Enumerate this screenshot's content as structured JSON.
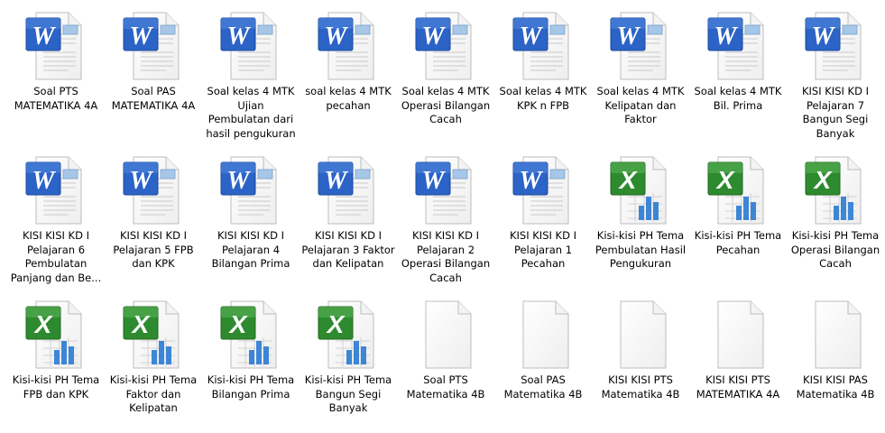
{
  "colors": {
    "word": "#2b63c6",
    "excel": "#2e8a2e",
    "page": "#ffffff",
    "page_edge": "#b9b9b9"
  },
  "files": [
    {
      "name": "Soal PTS\nMATEMATIKA 4A",
      "icon": "word-document-icon"
    },
    {
      "name": "Soal PAS\nMATEMATIKA 4A",
      "icon": "word-document-icon"
    },
    {
      "name": "Soal kelas 4 MTK\nUjian\nPembulatan dari\nhasil pengukuran",
      "icon": "word-document-icon"
    },
    {
      "name": "soal kelas 4 MTK\npecahan",
      "icon": "word-document-icon"
    },
    {
      "name": "Soal kelas 4 MTK\nOperasi Bilangan\nCacah",
      "icon": "word-document-icon"
    },
    {
      "name": "Soal kelas 4 MTK\nKPK n FPB",
      "icon": "word-document-icon"
    },
    {
      "name": "Soal kelas 4 MTK\nKelipatan dan\nFaktor",
      "icon": "word-document-icon"
    },
    {
      "name": "Soal kelas 4 MTK\nBil. Prima",
      "icon": "word-document-icon"
    },
    {
      "name": "KISI KISI KD I\nPelajaran 7\nBangun Segi\nBanyak",
      "icon": "word-document-icon"
    },
    {
      "name": "KISI KISI KD I\nPelajaran 6\nPembulatan\nPanjang dan Be...",
      "icon": "word-document-icon"
    },
    {
      "name": "KISI KISI KD I\nPelajaran 5 FPB\ndan KPK",
      "icon": "word-document-icon"
    },
    {
      "name": "KISI KISI KD I\nPelajaran 4\nBilangan Prima",
      "icon": "word-document-icon"
    },
    {
      "name": "KISI KISI KD I\nPelajaran 3 Faktor\ndan Kelipatan",
      "icon": "word-document-icon"
    },
    {
      "name": "KISI KISI KD I\nPelajaran 2\nOperasi Bilangan\nCacah",
      "icon": "word-document-icon"
    },
    {
      "name": "KISI KISI KD I\nPelajaran 1\nPecahan",
      "icon": "word-document-icon"
    },
    {
      "name": "Kisi-kisi PH Tema\nPembulatan Hasil\nPengukuran",
      "icon": "excel-spreadsheet-icon"
    },
    {
      "name": "Kisi-kisi PH Tema\nPecahan",
      "icon": "excel-spreadsheet-icon"
    },
    {
      "name": "Kisi-kisi PH Tema\nOperasi Bilangan\nCacah",
      "icon": "excel-spreadsheet-icon"
    },
    {
      "name": "Kisi-kisi PH Tema\nFPB dan KPK",
      "icon": "excel-spreadsheet-icon"
    },
    {
      "name": "Kisi-kisi PH Tema\nFaktor dan\nKelipatan",
      "icon": "excel-spreadsheet-icon"
    },
    {
      "name": "Kisi-kisi PH Tema\nBilangan Prima",
      "icon": "excel-spreadsheet-icon"
    },
    {
      "name": "Kisi-kisi PH Tema\nBangun Segi\nBanyak",
      "icon": "excel-spreadsheet-icon"
    },
    {
      "name": "Soal PTS\nMatematika 4B",
      "icon": "blank-file-icon"
    },
    {
      "name": "Soal PAS\nMatematika 4B",
      "icon": "blank-file-icon"
    },
    {
      "name": "KISI KISI PTS\nMatematika 4B",
      "icon": "blank-file-icon"
    },
    {
      "name": "KISI KISI PTS\nMATEMATIKA 4A",
      "icon": "blank-file-icon"
    },
    {
      "name": "KISI KISI PAS\nMatematika 4B",
      "icon": "blank-file-icon"
    }
  ]
}
